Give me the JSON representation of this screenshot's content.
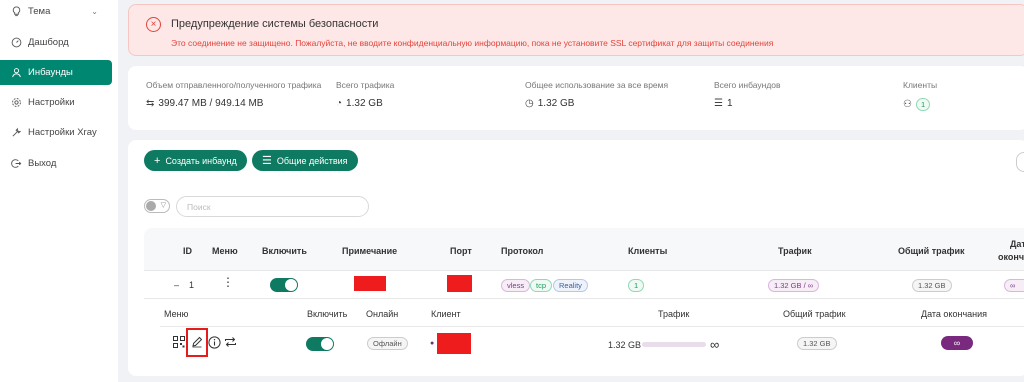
{
  "sidebar": {
    "items": [
      {
        "label": "Тема",
        "icon": "bulb-icon"
      },
      {
        "label": "Дашборд",
        "icon": "dashboard-icon"
      },
      {
        "label": "Инбаунды",
        "icon": "user-icon",
        "active": true
      },
      {
        "label": "Настройки",
        "icon": "gear-icon"
      },
      {
        "label": "Настройки Xray",
        "icon": "wrench-icon"
      },
      {
        "label": "Выход",
        "icon": "logout-icon"
      }
    ]
  },
  "alert": {
    "title": "Предупреждение системы безопасности",
    "message": "Это соединение не защищено. Пожалуйста, не вводите конфиденциальную информацию, пока не установите SSL сертификат для защиты соединения"
  },
  "stats": {
    "traffic_sent_recv_label": "Объем отправленного/полученного трафика",
    "traffic_sent_recv_value": "399.47 MB / 949.14 MB",
    "total_traffic_label": "Всего трафика",
    "total_traffic_value": "1.32 GB",
    "total_usage_label": "Общее использование за все время",
    "total_usage_value": "1.32 GB",
    "total_inbounds_label": "Всего инбаундов",
    "total_inbounds_value": "1",
    "clients_label": "Клиенты",
    "clients_value": "1"
  },
  "toolbar": {
    "create_label": "Создать инбаунд",
    "actions_label": "Общие действия",
    "search_placeholder": "Поиск"
  },
  "table": {
    "headers": [
      "ID",
      "Меню",
      "Включить",
      "Примечание",
      "Порт",
      "Протокол",
      "Клиенты",
      "Трафик",
      "Общий трафик",
      "Дата окончания"
    ],
    "expiry_header_visible": "Дат",
    "expiry_header_line2": "оконча",
    "row": {
      "id": "1",
      "expand": "–",
      "protocol_tags": [
        "vless",
        "tcp",
        "Reality"
      ],
      "clients": "1",
      "traffic": "1.32 GB / ∞",
      "total_traffic": "1.32 GB",
      "expiry": "∞",
      "enabled": true
    }
  },
  "client_table": {
    "headers": [
      "Меню",
      "Включить",
      "Онлайн",
      "Клиент",
      "Трафик",
      "Общий трафик",
      "Дата окончания"
    ],
    "row": {
      "online": "Офлайн",
      "traffic_used": "1.32 GB",
      "traffic_fraction": 0.0,
      "traffic_limit": "∞",
      "total_traffic": "1.32 GB",
      "expiry": "∞",
      "enabled": true
    }
  },
  "colors": {
    "accent": "#0e7a62",
    "danger": "#e5433a",
    "redacted": "#ee1c1c",
    "expiry_pill": "#7a2a7e"
  }
}
